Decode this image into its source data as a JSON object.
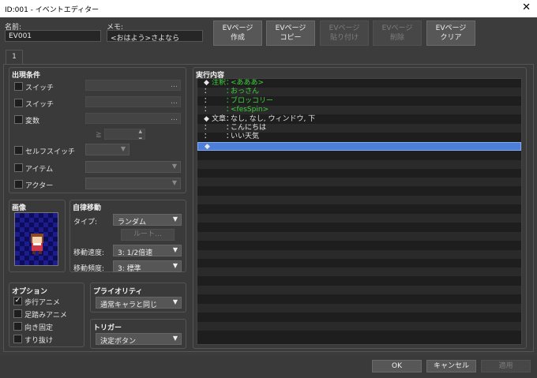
{
  "window": {
    "title": "ID:001 - イベントエディター",
    "close_glyph": "✕"
  },
  "header": {
    "name_label": "名前:",
    "name_value": "EV001",
    "memo_label": "メモ:",
    "memo_value": "<おはよう>さよなら"
  },
  "page_buttons": [
    {
      "line1": "EVページ",
      "line2": "作成",
      "enabled": true
    },
    {
      "line1": "EVページ",
      "line2": "コピー",
      "enabled": true
    },
    {
      "line1": "EVページ",
      "line2": "貼り付け",
      "enabled": false
    },
    {
      "line1": "EVページ",
      "line2": "削除",
      "enabled": false
    },
    {
      "line1": "EVページ",
      "line2": "クリア",
      "enabled": true
    }
  ],
  "tabs": [
    "1"
  ],
  "conditions": {
    "title": "出現条件",
    "switch1": "スイッチ",
    "switch2": "スイッチ",
    "variable": "変数",
    "variable_op": "≧",
    "self_switch": "セルフスイッチ",
    "item": "アイテム",
    "actor": "アクター",
    "ellipsis": "…"
  },
  "image": {
    "title": "画像"
  },
  "autonomous": {
    "title": "自律移動",
    "type_label": "タイプ:",
    "type_value": "ランダム",
    "route_button": "ルート…",
    "speed_label": "移動速度:",
    "speed_value": "3: 1/2倍速",
    "freq_label": "移動頻度:",
    "freq_value": "3: 標準"
  },
  "options": {
    "title": "オプション",
    "walking": "歩行アニメ",
    "stepping": "足踏みアニメ",
    "direction_fix": "向き固定",
    "through": "すり抜け",
    "walking_checked": true,
    "check_glyph": "✓"
  },
  "priority": {
    "title": "プライオリティ",
    "value": "通常キャラと同じ"
  },
  "trigger": {
    "title": "トリガー",
    "value": "決定ボタン"
  },
  "contents": {
    "title": "実行内容",
    "lines": [
      {
        "prefix": "◆",
        "label": "注釈：",
        "text": "<あああ>",
        "color": "#3ed23e"
      },
      {
        "prefix": "：",
        "label": "　　：",
        "text": "おっさん",
        "color": "#3ed23e"
      },
      {
        "prefix": "：",
        "label": "　　：",
        "text": "ブロッコリー",
        "color": "#3ed23e"
      },
      {
        "prefix": "：",
        "label": "　　：",
        "text": "<fesSpin>",
        "color": "#3ed23e"
      },
      {
        "prefix": "◆",
        "label": "文章：",
        "text": "なし, なし, ウィンドウ, 下",
        "color": "#e6e6e6"
      },
      {
        "prefix": "：",
        "label": "　　：",
        "text": "こんにちは",
        "color": "#e6e6e6"
      },
      {
        "prefix": "：",
        "label": "　　：",
        "text": "いい天気",
        "color": "#e6e6e6"
      },
      {
        "prefix": "◆",
        "label": "",
        "text": "",
        "color": "#e6e6e6"
      }
    ]
  },
  "footer": {
    "ok": "OK",
    "cancel": "キャンセル",
    "apply": "適用"
  },
  "colors": {
    "accent_selection": "#4d7fd8",
    "comment_green": "#3ed23e"
  },
  "image_preview": {
    "description_icon": "character-sprite-icon"
  }
}
